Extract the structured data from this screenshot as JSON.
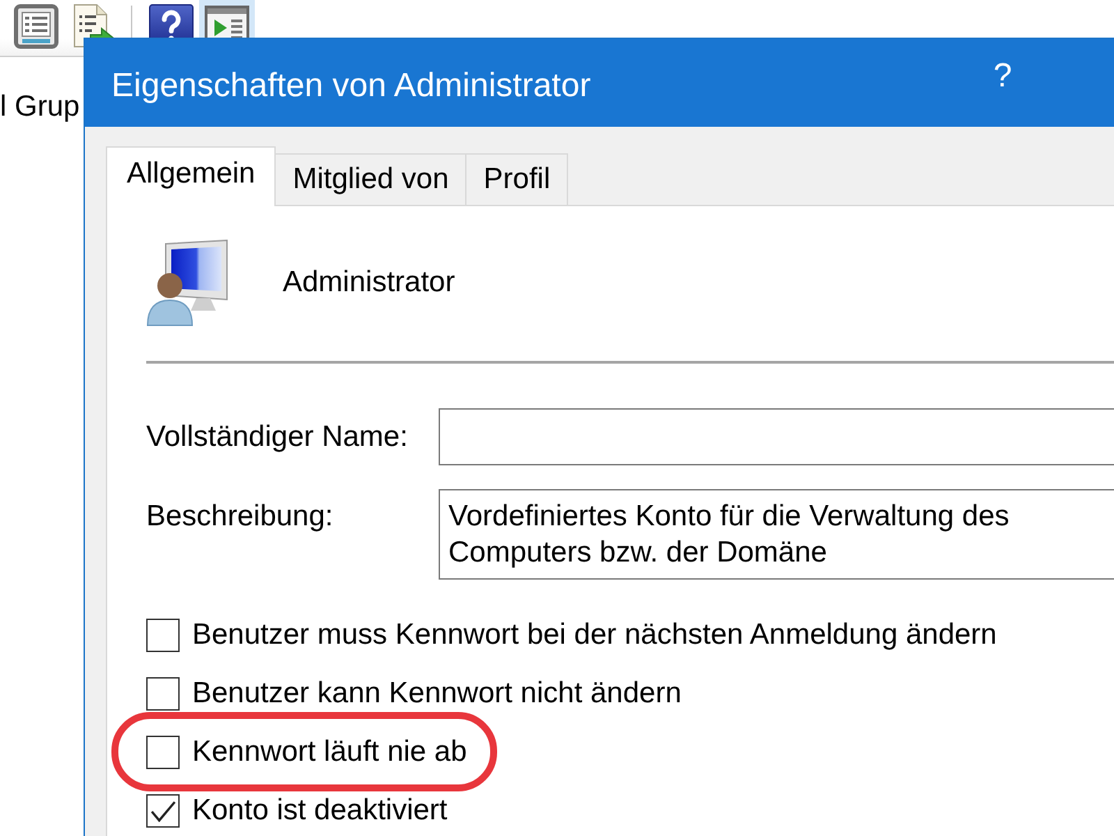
{
  "background_window": {
    "toolbar_groups": [
      {
        "buttons": [
          {
            "selected": false
          },
          {
            "selected": false
          }
        ]
      },
      {
        "buttons": [
          {
            "selected": false
          },
          {
            "selected": true
          }
        ]
      }
    ],
    "left_pane_item": "l Grup"
  },
  "dialog": {
    "title": "Eigenschaften von Administrator",
    "help_button": "?"
  },
  "tabs": [
    {
      "label": "Allgemein",
      "selected": true
    },
    {
      "label": "Mitglied von",
      "selected": false
    },
    {
      "label": "Profil",
      "selected": false
    }
  ],
  "account": {
    "name": "Administrator"
  },
  "fields": [
    {
      "label": "Vollständiger Name:",
      "kind": "single"
    },
    {
      "label": "Beschreibung:",
      "kind": "multi",
      "value": "Vordefiniertes Konto für die Verwaltung des Computers bzw. der Domäne"
    }
  ],
  "options": [
    {
      "label": "Benutzer muss Kennwort bei der nächsten Anmeldung ändern",
      "checked": false,
      "highlighted": false
    },
    {
      "label": "Benutzer kann Kennwort nicht ändern",
      "checked": false,
      "highlighted": false
    },
    {
      "label": "Kennwort läuft nie ab",
      "checked": false,
      "highlighted": true
    },
    {
      "label": "Konto ist deaktiviert",
      "checked": true,
      "highlighted": false
    }
  ]
}
